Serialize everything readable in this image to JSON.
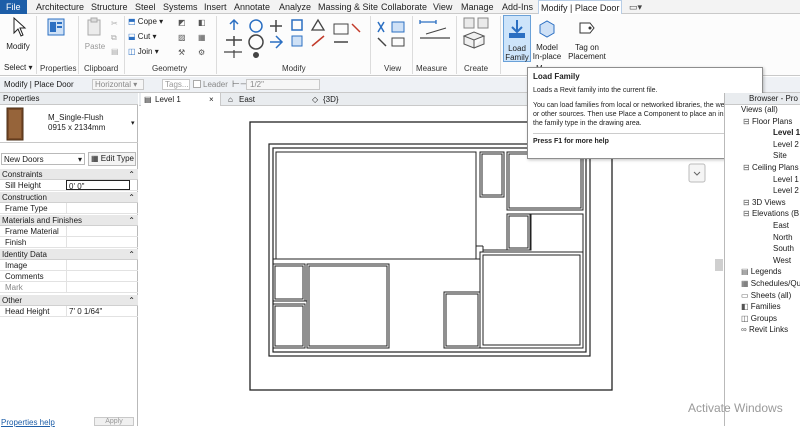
{
  "tabs": [
    "File",
    "Architecture",
    "Structure",
    "Steel",
    "Systems",
    "Insert",
    "Annotate",
    "Analyze",
    "Massing & Site",
    "Collaborate",
    "View",
    "Manage",
    "Add-Ins",
    "Modify | Place Door"
  ],
  "ribbon": {
    "modify": "Modify",
    "properties": "Properties",
    "paste": "Paste",
    "cope": "Cope",
    "cut": "Cut",
    "join": "Join",
    "load_family": "Load\nFamily",
    "model_inplace": "Model\nIn-place",
    "tag_on_placement": "Tag on\nPlacement",
    "panels": {
      "select": "Select",
      "properties": "Properties",
      "clipboard": "Clipboard",
      "geometry": "Geometry",
      "modify": "Modify",
      "view": "View",
      "measure": "Measure",
      "create": "Create",
      "mode": "M"
    }
  },
  "options_bar": {
    "context": "Modify | Place Door",
    "orientation": "Horizontal",
    "tags_placeholder": "Tags...",
    "leader": "Leader",
    "leader_length": "1/2\""
  },
  "properties_panel": {
    "title": "Properties",
    "family_name": "M_Single-Flush",
    "family_size": "0915 x 2134mm",
    "instance_filter": "New Doors",
    "edit_type": "Edit Type",
    "groups": [
      {
        "name": "Constraints",
        "rows": [
          {
            "k": "Sill Height",
            "v": "0'  0\""
          }
        ]
      },
      {
        "name": "Construction",
        "rows": [
          {
            "k": "Frame Type",
            "v": ""
          }
        ]
      },
      {
        "name": "Materials and Finishes",
        "rows": [
          {
            "k": "Frame Material",
            "v": ""
          },
          {
            "k": "Finish",
            "v": ""
          }
        ]
      },
      {
        "name": "Identity Data",
        "rows": [
          {
            "k": "Image",
            "v": ""
          },
          {
            "k": "Comments",
            "v": ""
          },
          {
            "k": "Mark",
            "v": ""
          }
        ]
      },
      {
        "name": "Other",
        "rows": [
          {
            "k": "Head Height",
            "v": "7'  0 1/64\""
          }
        ]
      }
    ],
    "help_link": "Properties help",
    "apply": "Apply"
  },
  "view_tabs": [
    "Level 1",
    "East",
    "{3D}"
  ],
  "tooltip": {
    "title": "Load Family",
    "line1": "Loads a Revit family into the current file.",
    "body": "You can load families from local or networked libraries, the web library, or other sources. Then use Place a Component to place an instance of the family type in the drawing area.",
    "help": "Press F1 for more help"
  },
  "project_browser": {
    "title": "Browser - Pro",
    "items": [
      {
        "label": "Views (all)",
        "indent": 0
      },
      {
        "label": "Floor Plans",
        "indent": 1
      },
      {
        "label": "Level 1",
        "indent": 2,
        "bold": true
      },
      {
        "label": "Level 2",
        "indent": 2
      },
      {
        "label": "Site",
        "indent": 2
      },
      {
        "label": "Ceiling Plans",
        "indent": 1
      },
      {
        "label": "Level 1",
        "indent": 2
      },
      {
        "label": "Level 2",
        "indent": 2
      },
      {
        "label": "3D Views",
        "indent": 1
      },
      {
        "label": "Elevations (B",
        "indent": 1
      },
      {
        "label": "East",
        "indent": 2
      },
      {
        "label": "North",
        "indent": 2
      },
      {
        "label": "South",
        "indent": 2
      },
      {
        "label": "West",
        "indent": 2
      },
      {
        "label": "Legends",
        "indent": 0
      },
      {
        "label": "Schedules/Qu",
        "indent": 0
      },
      {
        "label": "Sheets (all)",
        "indent": 0
      },
      {
        "label": "Families",
        "indent": 0
      },
      {
        "label": "Groups",
        "indent": 0
      },
      {
        "label": "Revit Links",
        "indent": 0
      }
    ]
  },
  "watermark": "Activate Windows",
  "colors": {
    "file_tab": "#1d5ea8",
    "accent": "#2b6fc2",
    "highlight": "#cde4fa"
  }
}
